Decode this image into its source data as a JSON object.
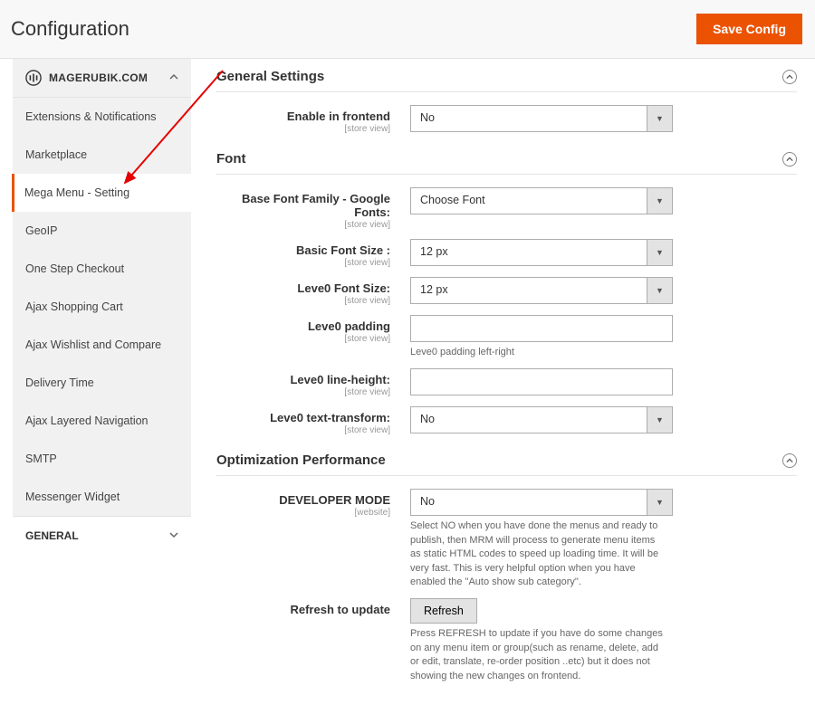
{
  "header": {
    "title": "Configuration",
    "save_label": "Save Config"
  },
  "sidebar": {
    "vendor_label": "MAGERUBIK.COM",
    "items": [
      {
        "label": "Extensions & Notifications"
      },
      {
        "label": "Marketplace"
      },
      {
        "label": "Mega Menu - Setting",
        "active": true
      },
      {
        "label": "GeoIP"
      },
      {
        "label": "One Step Checkout"
      },
      {
        "label": "Ajax Shopping Cart"
      },
      {
        "label": "Ajax Wishlist and Compare"
      },
      {
        "label": "Delivery Time"
      },
      {
        "label": "Ajax Layered Navigation"
      },
      {
        "label": "SMTP"
      },
      {
        "label": "Messenger Widget"
      }
    ],
    "general_label": "GENERAL"
  },
  "groups": {
    "general": {
      "title": "General Settings",
      "enable_label": "Enable in frontend",
      "enable_scope": "[store view]",
      "enable_value": "No"
    },
    "font": {
      "title": "Font",
      "base_family_label": "Base Font Family - Google Fonts:",
      "base_family_scope": "[store view]",
      "base_family_value": "Choose Font",
      "basic_size_label": "Basic Font Size :",
      "basic_size_scope": "[store view]",
      "basic_size_value": "12 px",
      "l0_size_label": "Leve0 Font Size:",
      "l0_size_scope": "[store view]",
      "l0_size_value": "12 px",
      "l0_padding_label": "Leve0 padding",
      "l0_padding_scope": "[store view]",
      "l0_padding_note": "Leve0 padding left-right",
      "l0_lineheight_label": "Leve0 line-height:",
      "l0_lineheight_scope": "[store view]",
      "l0_transform_label": "Leve0 text-transform:",
      "l0_transform_scope": "[store view]",
      "l0_transform_value": "No"
    },
    "optimization": {
      "title": "Optimization Performance",
      "dev_mode_label": "DEVELOPER MODE",
      "dev_mode_scope": "[website]",
      "dev_mode_value": "No",
      "dev_mode_note": "Select NO when you have done the menus and ready to publish, then MRM will process to generate menu items as static HTML codes to speed up loading time. It will be very fast. This is very helpful option when you have enabled the \"Auto show sub category\".",
      "refresh_label": "Refresh to update",
      "refresh_btn": "Refresh",
      "refresh_note": "Press REFRESH to update if you have do some changes on any menu item or group(such as rename, delete, add or edit, translate, re-order position ..etc) but it does not showing the new changes on frontend."
    }
  }
}
